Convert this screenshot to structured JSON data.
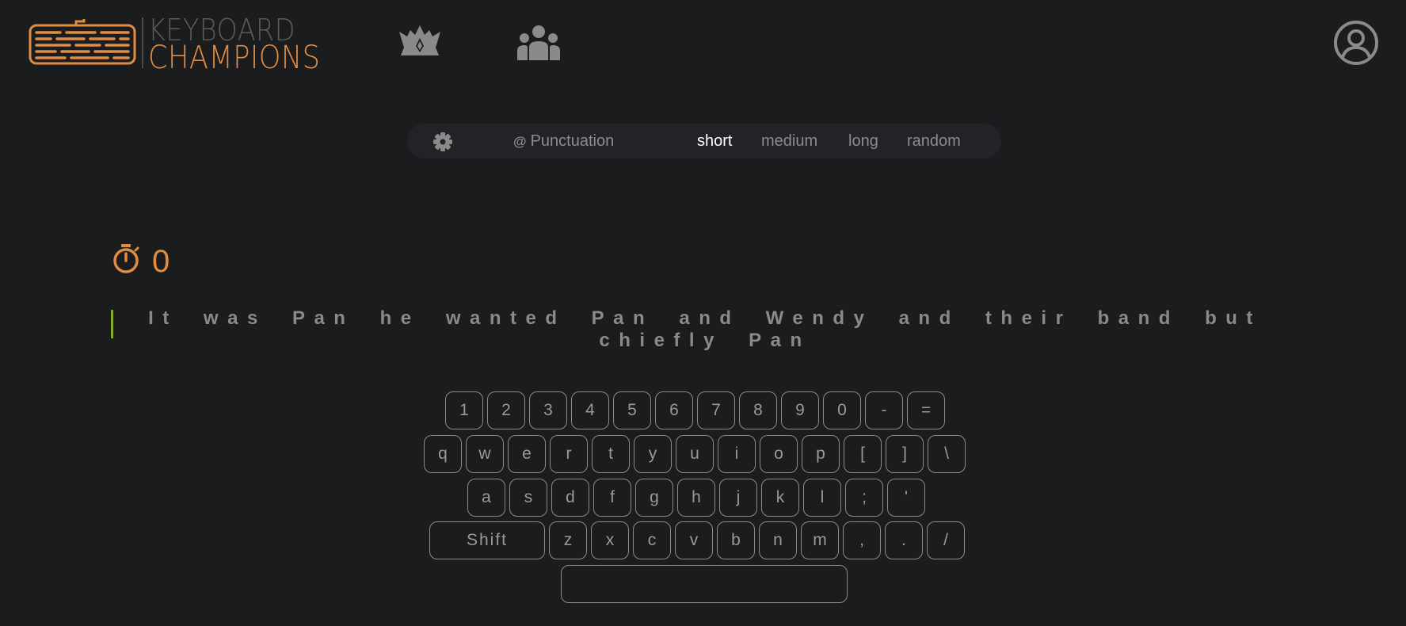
{
  "brand": {
    "name_top": "KEYBOARD",
    "name_bottom": "CHAMPIONS",
    "color_primary": "#e08c43",
    "color_secondary": "#5a5a5a"
  },
  "nav": {
    "items": [
      {
        "icon": "crown-icon"
      },
      {
        "icon": "people-icon"
      }
    ],
    "profile_icon": "user-circle-icon"
  },
  "settings": {
    "gear_icon": "gear-icon",
    "punctuation_prefix": "@",
    "punctuation_label": "Punctuation",
    "lengths": [
      "short",
      "medium",
      "long",
      "random"
    ],
    "selected_length": "short"
  },
  "timer": {
    "icon": "stopwatch-icon",
    "value": "0",
    "color": "#e08c43"
  },
  "typing": {
    "text": "It was Pan he wanted Pan and Wendy and their band but chiefly Pan",
    "caret_color": "#7fae2e"
  },
  "keyboard": {
    "rows": [
      [
        "1",
        "2",
        "3",
        "4",
        "5",
        "6",
        "7",
        "8",
        "9",
        "0",
        "-",
        "="
      ],
      [
        "q",
        "w",
        "e",
        "r",
        "t",
        "y",
        "u",
        "i",
        "o",
        "p",
        "[",
        "]",
        "\\"
      ],
      [
        "a",
        "s",
        "d",
        "f",
        "g",
        "h",
        "j",
        "k",
        "l",
        ";",
        "'"
      ],
      [
        "Shift",
        "z",
        "x",
        "c",
        "v",
        "b",
        "n",
        "m",
        ",",
        ".",
        "/"
      ],
      [
        ""
      ]
    ]
  }
}
